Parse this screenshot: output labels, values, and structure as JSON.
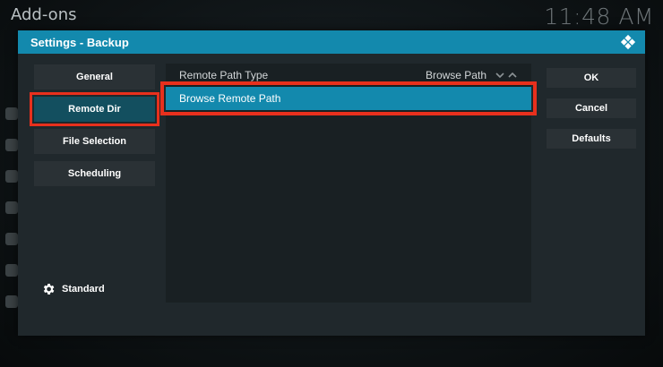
{
  "background": {
    "section_title": "Add-ons",
    "clock": "11:48 AM"
  },
  "dialog": {
    "title": "Settings - Backup",
    "categories": [
      {
        "label": "General",
        "active": false
      },
      {
        "label": "Remote Dir",
        "active": true
      },
      {
        "label": "File Selection",
        "active": false
      },
      {
        "label": "Scheduling",
        "active": false
      }
    ],
    "settings_level": "Standard",
    "settings": [
      {
        "label": "Remote Path Type",
        "value": "Browse Path"
      },
      {
        "label": "Browse Remote Path",
        "value": ""
      }
    ],
    "buttons": {
      "ok": "OK",
      "cancel": "Cancel",
      "defaults": "Defaults"
    }
  },
  "colors": {
    "accent": "#1389ad",
    "highlight_outline": "#e8301d",
    "dialog_bg": "#20282c"
  },
  "icons": [
    "kodi-logo-icon",
    "gear-icon",
    "spin-arrows-icon"
  ]
}
